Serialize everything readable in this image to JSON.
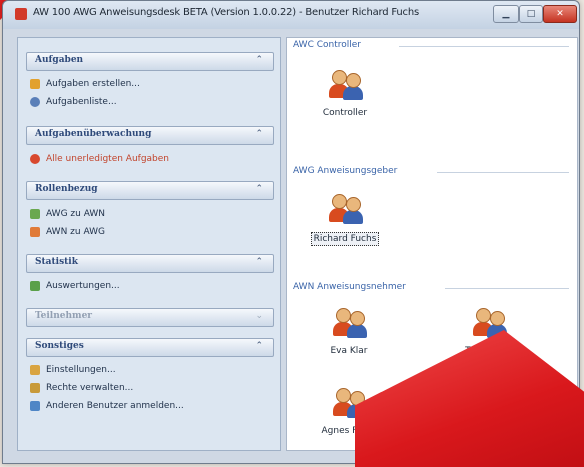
{
  "window": {
    "title": "AW 100 AWG Anweisungsdesk BETA (Version 1.0.0.22) - Benutzer Richard Fuchs"
  },
  "sidebar": {
    "sections": [
      {
        "label": "Aufgaben",
        "items": [
          {
            "label": "Aufgaben erstellen...",
            "icon": "new-task-icon"
          },
          {
            "label": "Aufgabenliste...",
            "icon": "task-list-icon"
          }
        ]
      },
      {
        "label": "Aufgabenüberwachung",
        "items": [
          {
            "label": "Alle unerledigten Aufgaben",
            "icon": "alert-icon"
          }
        ]
      },
      {
        "label": "Rollenbezug",
        "items": [
          {
            "label": "AWG zu AWN",
            "icon": "role-link-icon"
          },
          {
            "label": "AWN zu AWG",
            "icon": "role-link-reverse-icon"
          }
        ]
      },
      {
        "label": "Statistik",
        "items": [
          {
            "label": "Auswertungen...",
            "icon": "chart-icon"
          }
        ]
      },
      {
        "label": "Teilnehmer",
        "items": []
      },
      {
        "label": "Sonstiges",
        "items": [
          {
            "label": "Einstellungen...",
            "icon": "settings-icon"
          },
          {
            "label": "Rechte verwalten...",
            "icon": "rights-icon"
          },
          {
            "label": "Anderen Benutzer anmelden...",
            "icon": "switch-user-icon"
          }
        ]
      }
    ]
  },
  "groups": {
    "controller": {
      "label": "AWC Controller",
      "users": [
        "Controller"
      ]
    },
    "giver": {
      "label": "AWG Anweisungsgeber",
      "users": [
        "Richard Fuchs"
      ]
    },
    "taker": {
      "label": "AWN Anweisungsnehmer",
      "users": [
        "Eva Klar",
        "Tanja Logo",
        "Agnes Furaz"
      ]
    }
  },
  "colors": {
    "accent": "#d9181c",
    "link": "#3a64a8"
  }
}
